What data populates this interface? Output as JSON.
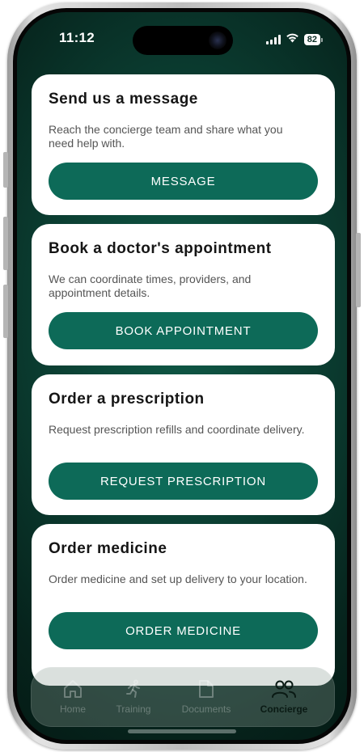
{
  "status_bar": {
    "time": "11:12",
    "battery": "82"
  },
  "cards": [
    {
      "title": "Send us a message",
      "description": "Reach the concierge team and share what you need help with.",
      "button_label": "MESSAGE"
    },
    {
      "title": "Book a doctor's appointment",
      "description": "We can coordinate times, providers, and appointment details.",
      "button_label": "BOOK APPOINTMENT"
    },
    {
      "title": "Order a prescription",
      "description": "Request prescription refills and coordinate delivery.",
      "button_label": "REQUEST PRESCRIPTION"
    },
    {
      "title": "Order medicine",
      "description": "Order medicine and set up delivery to your location.",
      "button_label": "ORDER MEDICINE"
    }
  ],
  "tab_bar": {
    "items": [
      {
        "label": "Home",
        "icon": "home-icon",
        "active": false
      },
      {
        "label": "Training",
        "icon": "running-figure-icon",
        "active": false
      },
      {
        "label": "Documents",
        "icon": "document-icon",
        "active": false
      },
      {
        "label": "Concierge",
        "icon": "people-icon",
        "active": true
      }
    ]
  },
  "colors": {
    "accent": "#0d6a58",
    "background_dark": "#0b3d31",
    "card": "#ffffff"
  }
}
